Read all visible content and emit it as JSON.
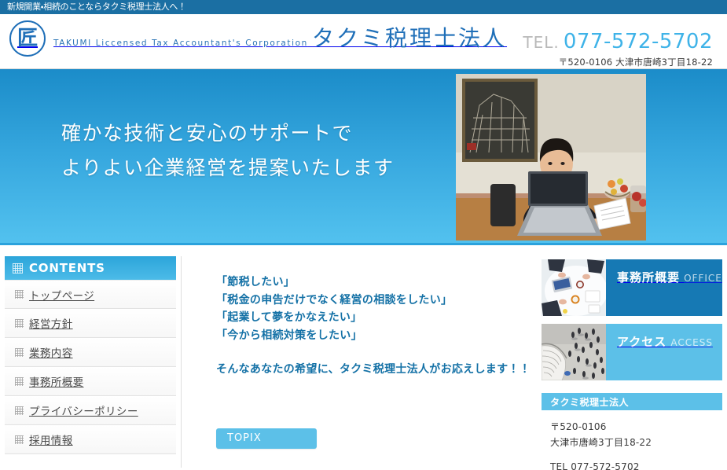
{
  "topbar": {
    "notice": "新規開業・相続のことならタクミ税理士法人へ！"
  },
  "header": {
    "logo_kanji": "匠",
    "brand_en": "TAKUMI Liccensed Tax Accountant's Corporation",
    "brand_jp": "タクミ税理士法人",
    "tel_label": "TEL.",
    "tel_number": "077-572-5702",
    "address": "〒520-0106 大津市唐崎3丁目18-22"
  },
  "hero": {
    "line1": "確かな技術と安心のサポートで",
    "line2": "よりよい企業経営を提案いたします",
    "photo_alt": "スーツ姿の税理士がノートパソコンと書類を持ちデスクに座る写真"
  },
  "sidebar": {
    "heading": "CONTENTS",
    "items": [
      {
        "label": "トップページ"
      },
      {
        "label": "経営方針"
      },
      {
        "label": "業務内容"
      },
      {
        "label": "事務所概要"
      },
      {
        "label": "プライバシーポリシー"
      },
      {
        "label": "採用情報"
      }
    ]
  },
  "main": {
    "lead_line1": "「節税したい」",
    "lead_line2": "「税金の申告だけでなく経営の相談をしたい」",
    "lead_line3": "「起業して夢をかなえたい」",
    "lead_line4": "「今から相続対策をしたい」",
    "lead_sub": "そんなあなたの希望に、タクミ税理士法人がお応えします！！",
    "topix_label": "TOPIX"
  },
  "rightcol": {
    "banners": [
      {
        "jp": "事務所概要",
        "en": "OFFICE",
        "thumb_alt": "会議テーブルを上から見た写真"
      },
      {
        "jp": "アクセス",
        "en": "ACCESS",
        "thumb_alt": "らせん階段と広場を上から見た写真"
      }
    ],
    "info": {
      "heading": "タクミ税理士法人",
      "postal": "〒520-0106",
      "address": "大津市唐崎3丁目18-22",
      "tel": "TEL 077-572-5702"
    }
  },
  "colors": {
    "topbar_blue": "#1b6fa3",
    "brand_blue": "#1f6fb8",
    "accent_cyan": "#5cc0e8",
    "hero_top": "#1b8cc9",
    "hero_bottom": "#53c2ef",
    "office_blue": "#1679b4",
    "lead_text": "#1471a6"
  }
}
